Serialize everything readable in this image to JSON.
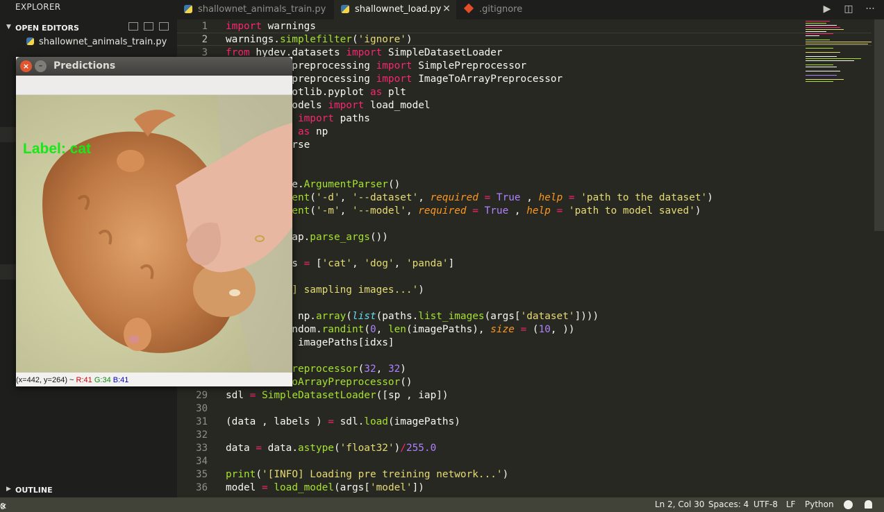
{
  "sidebar": {
    "title": "EXPLORER",
    "open_editors": {
      "label": "OPEN EDITORS",
      "file": "shallownet_animals_train.py"
    },
    "outline_label": "OUTLINE"
  },
  "tabs": [
    {
      "label": "shallownet_animals_train.py"
    },
    {
      "label": "shallownet_load.py"
    },
    {
      "label": ".gitignore"
    }
  ],
  "editor": {
    "line_numbers": [
      "1",
      "2",
      "3",
      "29",
      "30",
      "31",
      "32",
      "33",
      "34",
      "35",
      "36"
    ],
    "current_line": "2"
  },
  "popup": {
    "title": "Predictions",
    "overlay_label": "Label: cat",
    "status": {
      "coords": "(x=442, y=264) ~",
      "r": "R:41",
      "g": "G:34",
      "b": "B:41"
    }
  },
  "statusbar": {
    "errors": "0",
    "position": "Ln 2, Col 30",
    "spaces": "Spaces: 4",
    "encoding": "UTF-8",
    "eol": "LF",
    "language": "Python"
  }
}
